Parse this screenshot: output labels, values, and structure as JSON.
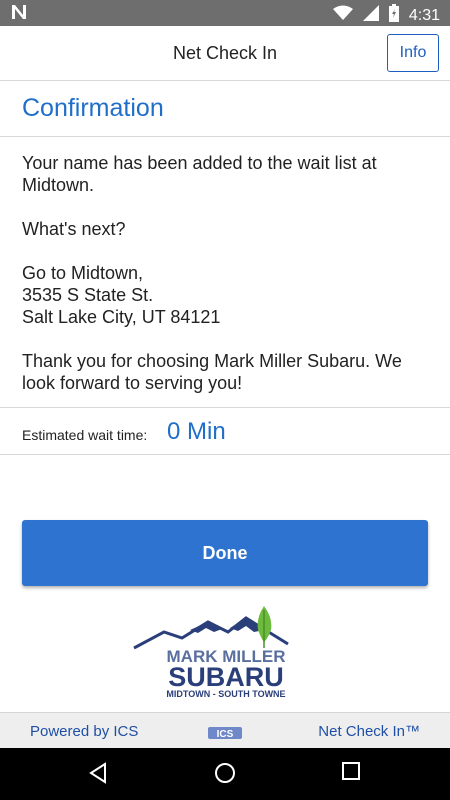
{
  "status_bar": {
    "time": "4:31",
    "icons": [
      "notification-n-icon",
      "wifi-icon",
      "signal-icon",
      "battery-icon"
    ]
  },
  "header": {
    "title": "Net Check In",
    "info_label": "Info"
  },
  "confirmation": {
    "title": "Confirmation",
    "message_line1": "Your name has been added to the wait list at",
    "message_line2": "Midtown.",
    "whats_next": "What's next?",
    "address_line1": "Go to Midtown,",
    "address_line2": "3535 S State St.",
    "address_line3": "Salt Lake City, UT 84121",
    "thanks_line1": "Thank you for choosing Mark Miller Subaru. We",
    "thanks_line2": "look forward to serving you!"
  },
  "wait": {
    "label": "Estimated wait time:",
    "value": "0 Min"
  },
  "done_label": "Done",
  "logo": {
    "line1": "MARK MILLER",
    "line2": "SUBARU",
    "line3": "MIDTOWN - SOUTH TOWNE"
  },
  "footer": {
    "powered_by": "Powered by ICS",
    "ics_logo": "ICS",
    "product": "Net Check In™"
  },
  "nav_bar": {
    "icons": [
      "back-icon",
      "home-icon",
      "recents-icon"
    ]
  },
  "colors": {
    "accent_blue": "#1f6fc9",
    "button_blue": "#2f73d0",
    "status_bar": "#6e6e6e",
    "logo_navy": "#2a3f7a",
    "logo_green": "#6dbb3e"
  }
}
